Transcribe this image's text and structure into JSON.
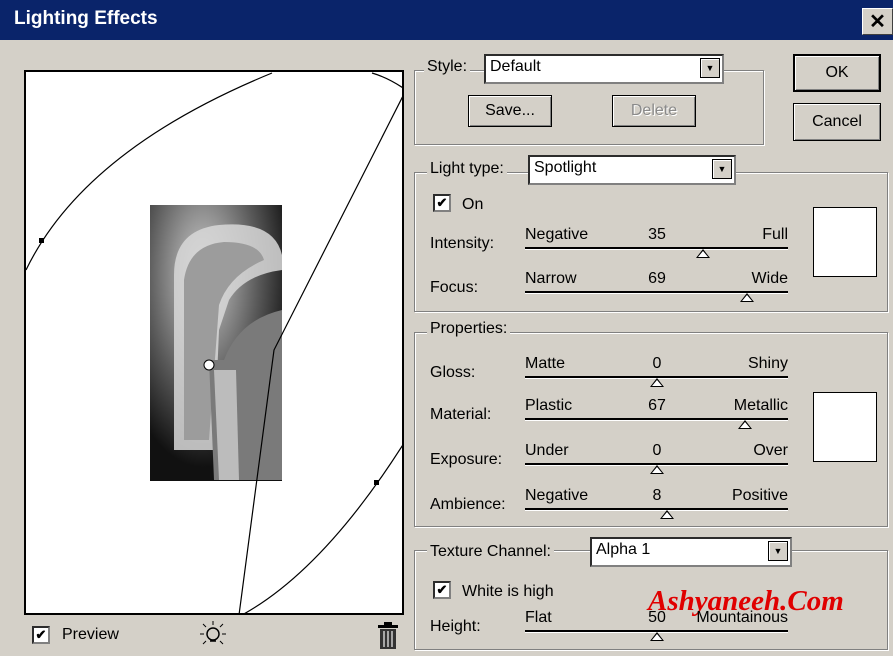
{
  "window": {
    "title": "Lighting Effects"
  },
  "preview_panel": {
    "checkbox_label": "Preview",
    "checked": true
  },
  "style": {
    "label": "Style:",
    "value": "Default",
    "save_label": "Save...",
    "delete_label": "Delete"
  },
  "buttons": {
    "ok": "OK",
    "cancel": "Cancel"
  },
  "light_type": {
    "label": "Light type:",
    "value": "Spotlight",
    "on_label": "On",
    "on_checked": true,
    "intensity": {
      "label": "Intensity:",
      "left": "Negative",
      "value": "35",
      "right": "Full",
      "fraction": 0.675
    },
    "focus": {
      "label": "Focus:",
      "left": "Narrow",
      "value": "69",
      "right": "Wide",
      "fraction": 0.845
    },
    "color": "#ffffff"
  },
  "properties": {
    "label": "Properties:",
    "gloss": {
      "label": "Gloss:",
      "left": "Matte",
      "value": "0",
      "right": "Shiny",
      "fraction": 0.5
    },
    "material": {
      "label": "Material:",
      "left": "Plastic",
      "value": "67",
      "right": "Metallic",
      "fraction": 0.835
    },
    "exposure": {
      "label": "Exposure:",
      "left": "Under",
      "value": "0",
      "right": "Over",
      "fraction": 0.5
    },
    "ambience": {
      "label": "Ambience:",
      "left": "Negative",
      "value": "8",
      "right": "Positive",
      "fraction": 0.54
    },
    "color": "#ffffff"
  },
  "texture": {
    "label": "Texture Channel:",
    "value": "Alpha 1",
    "white_is_high_label": "White is high",
    "white_is_high_checked": true,
    "height": {
      "label": "Height:",
      "left": "Flat",
      "value": "50",
      "right": "Mountainous",
      "fraction": 0.5
    }
  },
  "watermark": "Ashyaneeh.Com",
  "icons": {
    "light": "lightbulb-icon",
    "trash": "trash-icon",
    "dropdown": "chevron-down-icon"
  }
}
